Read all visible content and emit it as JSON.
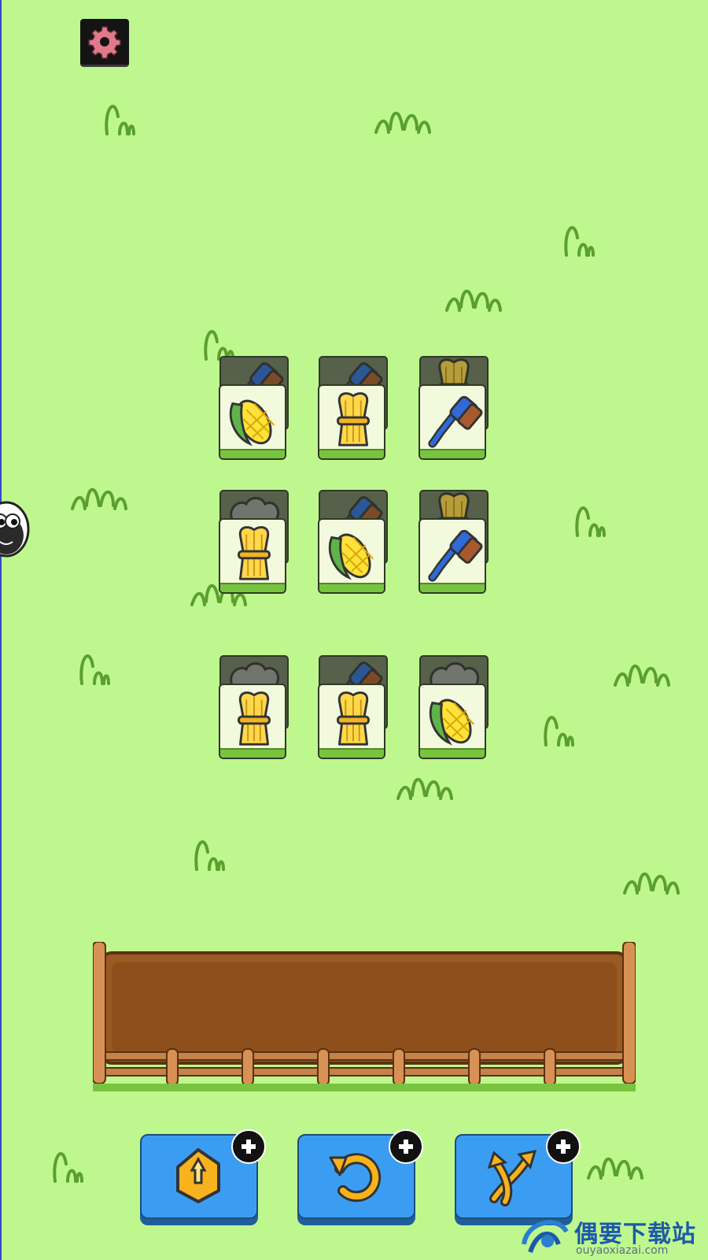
{
  "screen": {
    "background": "#bff78f"
  },
  "settings": {
    "icon": "gear-icon",
    "icon_color": "#e07a8a"
  },
  "board": {
    "tiles": [
      {
        "face": "corn",
        "under": "brush"
      },
      {
        "face": "wheat",
        "under": "brush"
      },
      {
        "face": "brush",
        "under": "wheat"
      },
      {
        "face": "wheat",
        "under": "wool"
      },
      {
        "face": "corn",
        "under": "brush"
      },
      {
        "face": "brush",
        "under": "wheat"
      },
      {
        "face": "wheat",
        "under": "wool"
      },
      {
        "face": "wheat",
        "under": "brush"
      },
      {
        "face": "corn",
        "under": "wool"
      }
    ]
  },
  "tray": {
    "slots_filled": 0
  },
  "powerups": [
    {
      "name": "remove",
      "icon": "remove-tiles-icon"
    },
    {
      "name": "undo",
      "icon": "undo-icon"
    },
    {
      "name": "shuffle",
      "icon": "shuffle-icon"
    }
  ],
  "watermark": {
    "title": "偶要下载站",
    "url": "ouyaoxiazai.com"
  }
}
